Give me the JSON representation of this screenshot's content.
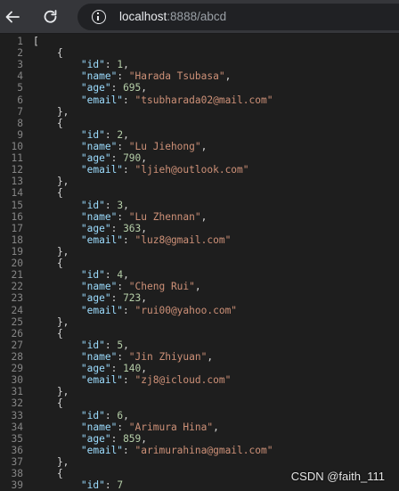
{
  "browser": {
    "url_host": "localhost",
    "url_rest": ":8888/abcd",
    "icons": {
      "back": "back-arrow-icon",
      "reload": "reload-icon",
      "info": "info-icon"
    }
  },
  "code": {
    "records": [
      {
        "id": 1,
        "name": "Harada Tsubasa",
        "age": 695,
        "email": "tsubharada02@mail.com"
      },
      {
        "id": 2,
        "name": "Lu Jiehong",
        "age": 790,
        "email": "ljieh@outlook.com"
      },
      {
        "id": 3,
        "name": "Lu Zhennan",
        "age": 363,
        "email": "luz8@gmail.com"
      },
      {
        "id": 4,
        "name": "Cheng Rui",
        "age": 723,
        "email": "rui00@yahoo.com"
      },
      {
        "id": 5,
        "name": "Jin Zhiyuan",
        "age": 140,
        "email": "zj8@icloud.com"
      },
      {
        "id": 6,
        "name": "Arimura Hina",
        "age": 859,
        "email": "arimurahina@gmail.com"
      },
      {
        "id": 7
      }
    ]
  },
  "watermark": "CSDN @faith_111"
}
